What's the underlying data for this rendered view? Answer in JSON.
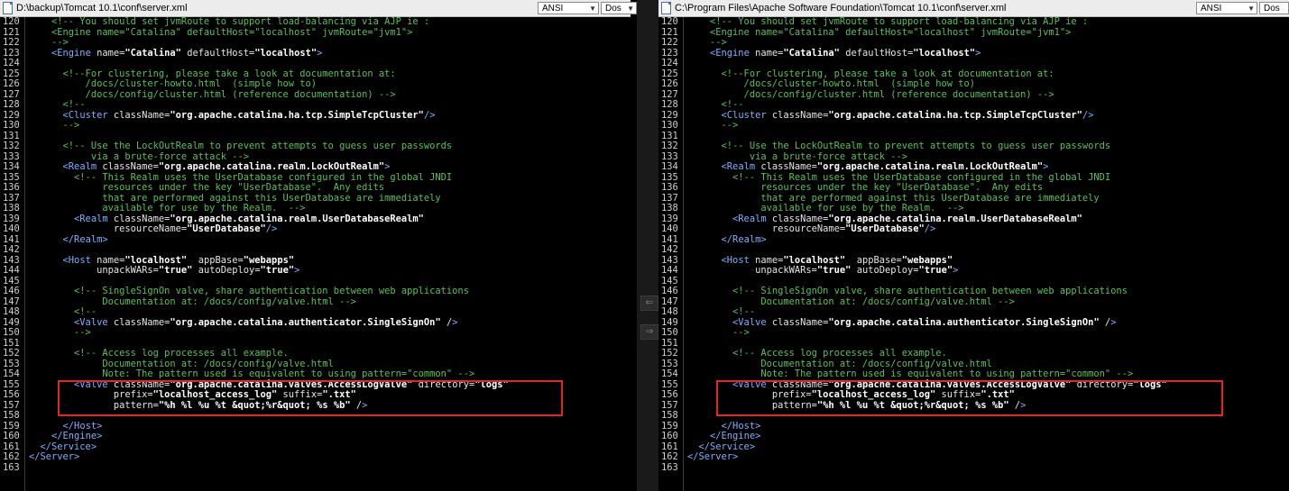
{
  "left_pane": {
    "path": "D:\\backup\\Tomcat 10.1\\conf\\server.xml",
    "encoding": "ANSI",
    "line_ending": "Dos"
  },
  "right_pane": {
    "path": "C:\\Program Files\\Apache Software Foundation\\Tomcat 10.1\\conf\\server.xml",
    "encoding": "ANSI",
    "line_ending": "Dos"
  },
  "compare_nav": {
    "prev_label": "⇐",
    "next_label": "⇒"
  },
  "colors": {
    "comment": "#57c257",
    "tag": "#7fb0ff",
    "value": "#ffffff",
    "highlight_box": "#e0262c"
  },
  "code_lines": [
    {
      "n": "120",
      "text": "    <!-- You should set jvmRoute to support load-balancing via AJP ie :"
    },
    {
      "n": "121",
      "text": "    <Engine name=\"Catalina\" defaultHost=\"localhost\" jvmRoute=\"jvm1\">"
    },
    {
      "n": "122",
      "text": "    -->"
    },
    {
      "n": "123",
      "text": "    <Engine name=\"Catalina\" defaultHost=\"localhost\">"
    },
    {
      "n": "124",
      "text": ""
    },
    {
      "n": "125",
      "text": "      <!--For clustering, please take a look at documentation at:"
    },
    {
      "n": "126",
      "text": "          /docs/cluster-howto.html  (simple how to)"
    },
    {
      "n": "127",
      "text": "          /docs/config/cluster.html (reference documentation) -->"
    },
    {
      "n": "128",
      "text": "      <!--"
    },
    {
      "n": "129",
      "text": "      <Cluster className=\"org.apache.catalina.ha.tcp.SimpleTcpCluster\"/>"
    },
    {
      "n": "130",
      "text": "      -->"
    },
    {
      "n": "131",
      "text": ""
    },
    {
      "n": "132",
      "text": "      <!-- Use the LockOutRealm to prevent attempts to guess user passwords"
    },
    {
      "n": "133",
      "text": "           via a brute-force attack -->"
    },
    {
      "n": "134",
      "text": "      <Realm className=\"org.apache.catalina.realm.LockOutRealm\">"
    },
    {
      "n": "135",
      "text": "        <!-- This Realm uses the UserDatabase configured in the global JNDI"
    },
    {
      "n": "136",
      "text": "             resources under the key \"UserDatabase\".  Any edits"
    },
    {
      "n": "137",
      "text": "             that are performed against this UserDatabase are immediately"
    },
    {
      "n": "138",
      "text": "             available for use by the Realm.  -->"
    },
    {
      "n": "139",
      "text": "        <Realm className=\"org.apache.catalina.realm.UserDatabaseRealm\""
    },
    {
      "n": "140",
      "text": "               resourceName=\"UserDatabase\"/>"
    },
    {
      "n": "141",
      "text": "      </Realm>"
    },
    {
      "n": "142",
      "text": ""
    },
    {
      "n": "143",
      "text": "      <Host name=\"localhost\"  appBase=\"webapps\""
    },
    {
      "n": "144",
      "text": "            unpackWARs=\"true\" autoDeploy=\"true\">"
    },
    {
      "n": "145",
      "text": ""
    },
    {
      "n": "146",
      "text": "        <!-- SingleSignOn valve, share authentication between web applications"
    },
    {
      "n": "147",
      "text": "             Documentation at: /docs/config/valve.html -->"
    },
    {
      "n": "148",
      "text": "        <!--"
    },
    {
      "n": "149",
      "text": "        <Valve className=\"org.apache.catalina.authenticator.SingleSignOn\" />"
    },
    {
      "n": "150",
      "text": "        -->"
    },
    {
      "n": "151",
      "text": ""
    },
    {
      "n": "152",
      "text": "        <!-- Access log processes all example."
    },
    {
      "n": "153",
      "text": "             Documentation at: /docs/config/valve.html"
    },
    {
      "n": "154",
      "text": "             Note: The pattern used is equivalent to using pattern=\"common\" -->"
    },
    {
      "n": "155",
      "text": "        <Valve className=\"org.apache.catalina.valves.AccessLogValve\" directory=\"logs\""
    },
    {
      "n": "156",
      "text": "               prefix=\"localhost_access_log\" suffix=\".txt\""
    },
    {
      "n": "157",
      "text": "               pattern=\"%h %l %u %t &quot;%r&quot; %s %b\" />"
    },
    {
      "n": "158",
      "text": ""
    },
    {
      "n": "159",
      "text": "      </Host>"
    },
    {
      "n": "160",
      "text": "    </Engine>"
    },
    {
      "n": "161",
      "text": "  </Service>"
    },
    {
      "n": "162",
      "text": "</Server>"
    },
    {
      "n": "163",
      "text": ""
    }
  ]
}
